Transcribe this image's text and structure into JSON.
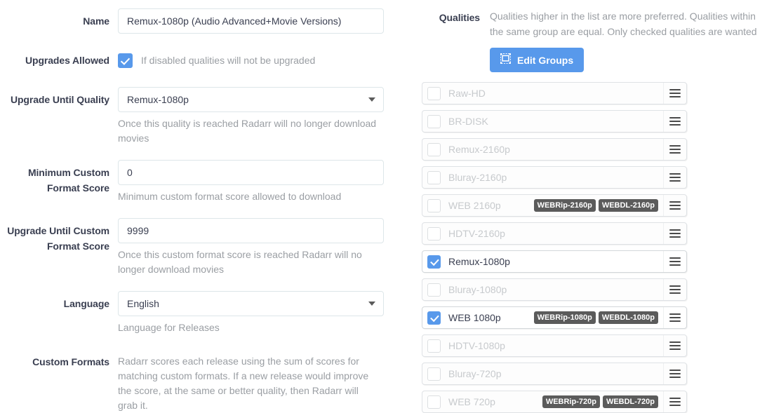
{
  "form": {
    "name": {
      "label": "Name",
      "value": "Remux-1080p (Audio Advanced+Movie Versions)",
      "placeholder": ""
    },
    "upgrades_allowed": {
      "label": "Upgrades Allowed",
      "checked": true,
      "checkbox_label": "If disabled qualities will not be upgraded"
    },
    "upgrade_until_quality": {
      "label": "Upgrade Until Quality",
      "value": "Remux-1080p",
      "help": "Once this quality is reached Radarr will no longer download movies"
    },
    "minimum_custom_format_score": {
      "label": "Minimum Custom Format Score",
      "value": "0",
      "help": "Minimum custom format score allowed to download"
    },
    "upgrade_until_custom_format_score": {
      "label": "Upgrade Until Custom Format Score",
      "value": "9999",
      "help": "Once this custom format score is reached Radarr will no longer download movies"
    },
    "language": {
      "label": "Language",
      "value": "English",
      "help": "Language for Releases"
    },
    "custom_formats": {
      "label": "Custom Formats",
      "help": "Radarr scores each release using the sum of scores for matching custom formats. If a new release would improve the score, at the same or better quality, then Radarr will grab it."
    }
  },
  "qualities": {
    "label": "Qualities",
    "description": "Qualities higher in the list are more preferred. Qualities within the same group are equal. Only checked qualities are wanted",
    "edit_groups_button": "Edit Groups",
    "edit_groups_icon": "object-group-icon",
    "drag_handle_icon": "drag-handle-icon",
    "items": [
      {
        "name": "Raw-HD",
        "checked": false,
        "badges": []
      },
      {
        "name": "BR-DISK",
        "checked": false,
        "badges": []
      },
      {
        "name": "Remux-2160p",
        "checked": false,
        "badges": []
      },
      {
        "name": "Bluray-2160p",
        "checked": false,
        "badges": []
      },
      {
        "name": "WEB 2160p",
        "checked": false,
        "badges": [
          "WEBRip-2160p",
          "WEBDL-2160p"
        ]
      },
      {
        "name": "HDTV-2160p",
        "checked": false,
        "badges": []
      },
      {
        "name": "Remux-1080p",
        "checked": true,
        "badges": []
      },
      {
        "name": "Bluray-1080p",
        "checked": false,
        "badges": []
      },
      {
        "name": "WEB 1080p",
        "checked": true,
        "badges": [
          "WEBRip-1080p",
          "WEBDL-1080p"
        ]
      },
      {
        "name": "HDTV-1080p",
        "checked": false,
        "badges": []
      },
      {
        "name": "Bluray-720p",
        "checked": false,
        "badges": []
      },
      {
        "name": "WEB 720p",
        "checked": false,
        "badges": [
          "WEBRip-720p",
          "WEBDL-720p"
        ]
      }
    ]
  },
  "colors": {
    "accent": "#5899eb",
    "badge_bg": "#5b5b5b",
    "label_text": "#3a3f51",
    "muted_text": "#9a9ea3",
    "disabled_text": "#c7cacd",
    "border": "#dde6e9"
  }
}
